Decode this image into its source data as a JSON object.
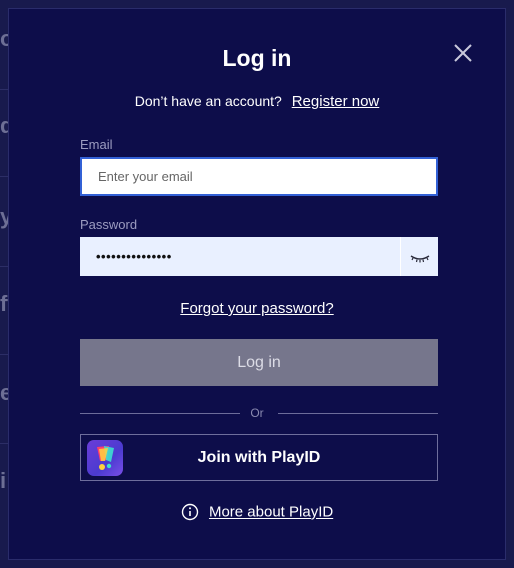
{
  "background": {
    "letters": [
      "o",
      "d",
      "y",
      "ft",
      "e",
      "i"
    ]
  },
  "modal": {
    "title": "Log in",
    "close_icon": "close-icon",
    "register_prompt": "Don’t have an account?",
    "register_link": "Register now",
    "email": {
      "label": "Email",
      "placeholder": "Enter your email",
      "value": ""
    },
    "password": {
      "label": "Password",
      "masked_value": "•••••••••••••••",
      "toggle_icon": "eye-closed-icon"
    },
    "forgot_link": "Forgot your password?",
    "login_button": "Log in",
    "divider_text": "Or",
    "playid_button": "Join with PlayID",
    "playid_icon": "playid-logo-icon",
    "more_icon": "info-icon",
    "more_link": "More about PlayID"
  },
  "colors": {
    "modal_bg": "#0d0d4a",
    "focus_border": "#3361d6",
    "login_disabled_bg": "#76768c",
    "password_field_bg": "#e9f0ff"
  }
}
